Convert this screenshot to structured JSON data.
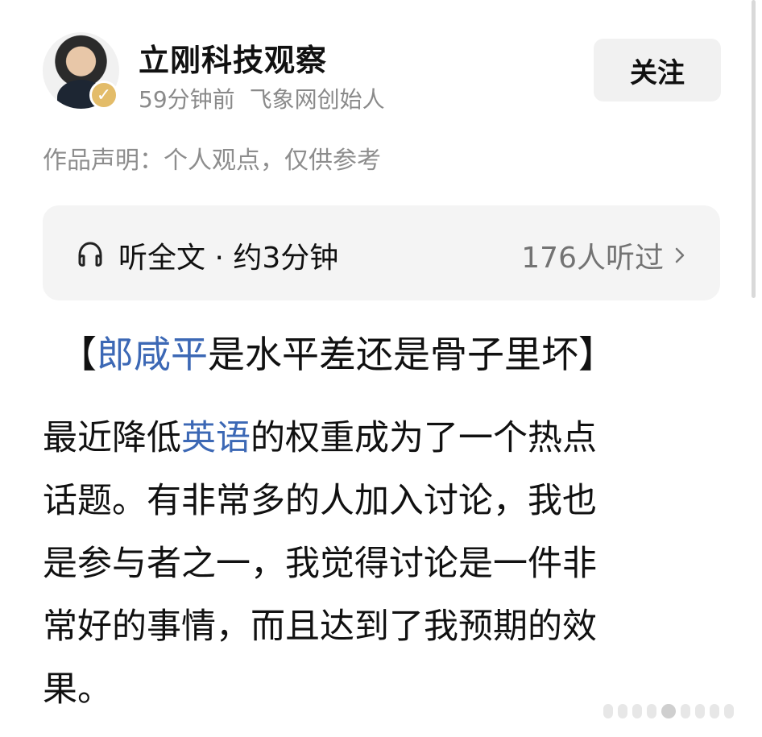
{
  "author": {
    "name": "立刚科技观察",
    "time": "59分钟前",
    "title": "飞象网创始人",
    "follow_label": "关注"
  },
  "statement": "作品声明：个人观点，仅供参考",
  "audio": {
    "label": "听全文 · 约3分钟",
    "listeners": "176人听过"
  },
  "article": {
    "headline_prefix": "【",
    "headline_link": "郎咸平",
    "headline_suffix": "是水平差还是骨子里坏】",
    "body_lines": [
      {
        "pre": "最近降低",
        "link": "英语",
        "post": "的权重成为了一个热点"
      },
      {
        "text": "话题。有非常多的人加入讨论，我也"
      },
      {
        "text": "是参与者之一，我觉得讨论是一件非"
      },
      {
        "text": "常好的事情，而且达到了我预期的效"
      },
      {
        "text": "果。"
      }
    ]
  },
  "icons": {
    "verified": "verified-badge-icon",
    "headphones": "headphones-icon",
    "chevron": "chevron-right-icon"
  },
  "colors": {
    "link": "#3c68b5",
    "muted": "#8d8d8d",
    "surface": "#f4f4f4",
    "verified": "#e3bc69"
  }
}
